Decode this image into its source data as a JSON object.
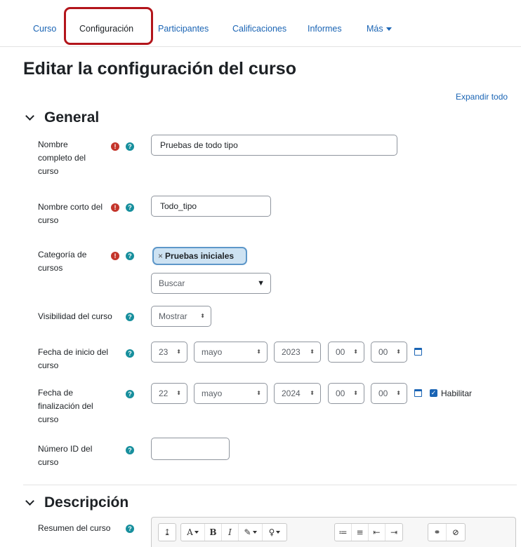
{
  "nav": {
    "items": [
      "Curso",
      "Configuración",
      "Participantes",
      "Calificaciones",
      "Informes",
      "Más"
    ],
    "active": "Configuración"
  },
  "page_title": "Editar la configuración del curso",
  "expand_all": "Expandir todo",
  "general": {
    "title": "General",
    "full_name": {
      "label": "Nombre completo del curso",
      "value": "Pruebas de todo tipo"
    },
    "short_name": {
      "label": "Nombre corto del curso",
      "value": "Todo_tipo"
    },
    "category": {
      "label": "Categoría de cursos",
      "tag_remove": "×",
      "tag": "Pruebas iniciales",
      "search_placeholder": "Buscar"
    },
    "visibility": {
      "label": "Visibilidad del curso",
      "value": "Mostrar"
    },
    "start_date": {
      "label": "Fecha de inicio del curso",
      "day": "23",
      "month": "mayo",
      "year": "2023",
      "hour": "00",
      "minute": "00"
    },
    "end_date": {
      "label": "Fecha de finalización del curso",
      "day": "22",
      "month": "mayo",
      "year": "2024",
      "hour": "00",
      "minute": "00",
      "enable_label": "Habilitar",
      "enabled": true
    },
    "id_number": {
      "label": "Número ID del curso",
      "value": ""
    }
  },
  "description": {
    "title": "Descripción",
    "summary_label": "Resumen del curso"
  },
  "icons": {
    "required": "exclamation-circle-icon",
    "help": "question-circle-icon",
    "calendar": "calendar-icon",
    "checkbox": "checkbox-checked-icon"
  },
  "toolbar": {
    "collapse": "↨",
    "font": "A",
    "bold": "B",
    "italic": "I",
    "brush": "✎",
    "bulb": "♀",
    "list_ul": "≔",
    "list_ol": "≡",
    "outdent": "⇤",
    "indent": "⇥",
    "link": "⚭",
    "unlink": "⊘"
  },
  "colors": {
    "link": "#1a64b4",
    "required": "#c4352b",
    "help": "#178f9d",
    "highlight": "#b3151b",
    "tag_bg": "#cde2f2"
  }
}
